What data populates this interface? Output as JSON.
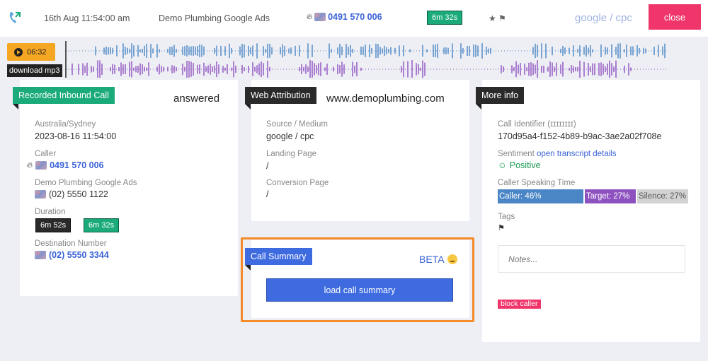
{
  "header": {
    "date": "16th Aug 11:54:00 am",
    "campaign": "Demo Plumbing Google Ads",
    "phone": "0491 570 006",
    "duration": "6m 32s",
    "source": "google / cpc",
    "close_label": "close",
    "icons": [
      "flame-icon",
      "flag-icon",
      "star-icon",
      "tag-icon"
    ]
  },
  "player": {
    "time": "06:32",
    "download_label": "download mp3",
    "colors": {
      "caller_wave": "#4a86c5",
      "target_wave": "#8e52c0",
      "play": "#f5a623"
    }
  },
  "inbound": {
    "tag": "Recorded Inbound Call",
    "status": "answered",
    "timezone": "Australia/Sydney",
    "datetime": "2023-08-16 11:54:00",
    "caller_label": "Caller",
    "caller_phone": "0491 570 006",
    "campaign": "Demo Plumbing Google Ads",
    "campaign_phone": "(02) 5550 1122",
    "duration_label": "Duration",
    "duration_total": "6m 52s",
    "duration_talk": "6m 32s",
    "destination_label": "Destination Number",
    "destination_phone": "(02) 5550 3344"
  },
  "attribution": {
    "tag": "Web Attribution",
    "domain": "www.demoplumbing.com",
    "source_label": "Source / Medium",
    "source_value": "google / cpc",
    "landing_label": "Landing Page",
    "landing_value": "/",
    "conversion_label": "Conversion Page",
    "conversion_value": "/"
  },
  "summary": {
    "tag": "Call Summary",
    "beta": "BETA",
    "button_label": "load call summary"
  },
  "more": {
    "tag": "More info",
    "identifier_label": "Call Identifier (ɪɪɪɪɪɪɪɪ)",
    "identifier_value": "170d95a4-f152-4b89-b9ac-3ae2a02f708e",
    "sentiment_label": "Sentiment",
    "transcript_link": "open transcript details",
    "sentiment_value": "Positive",
    "speaking_label": "Caller Speaking Time",
    "caller_pct": "Caller: 46%",
    "target_pct": "Target: 27%",
    "silence_pct": "Silence: 27%",
    "tags_label": "Tags",
    "notes_placeholder": "Notes...",
    "block_label": "block caller"
  }
}
